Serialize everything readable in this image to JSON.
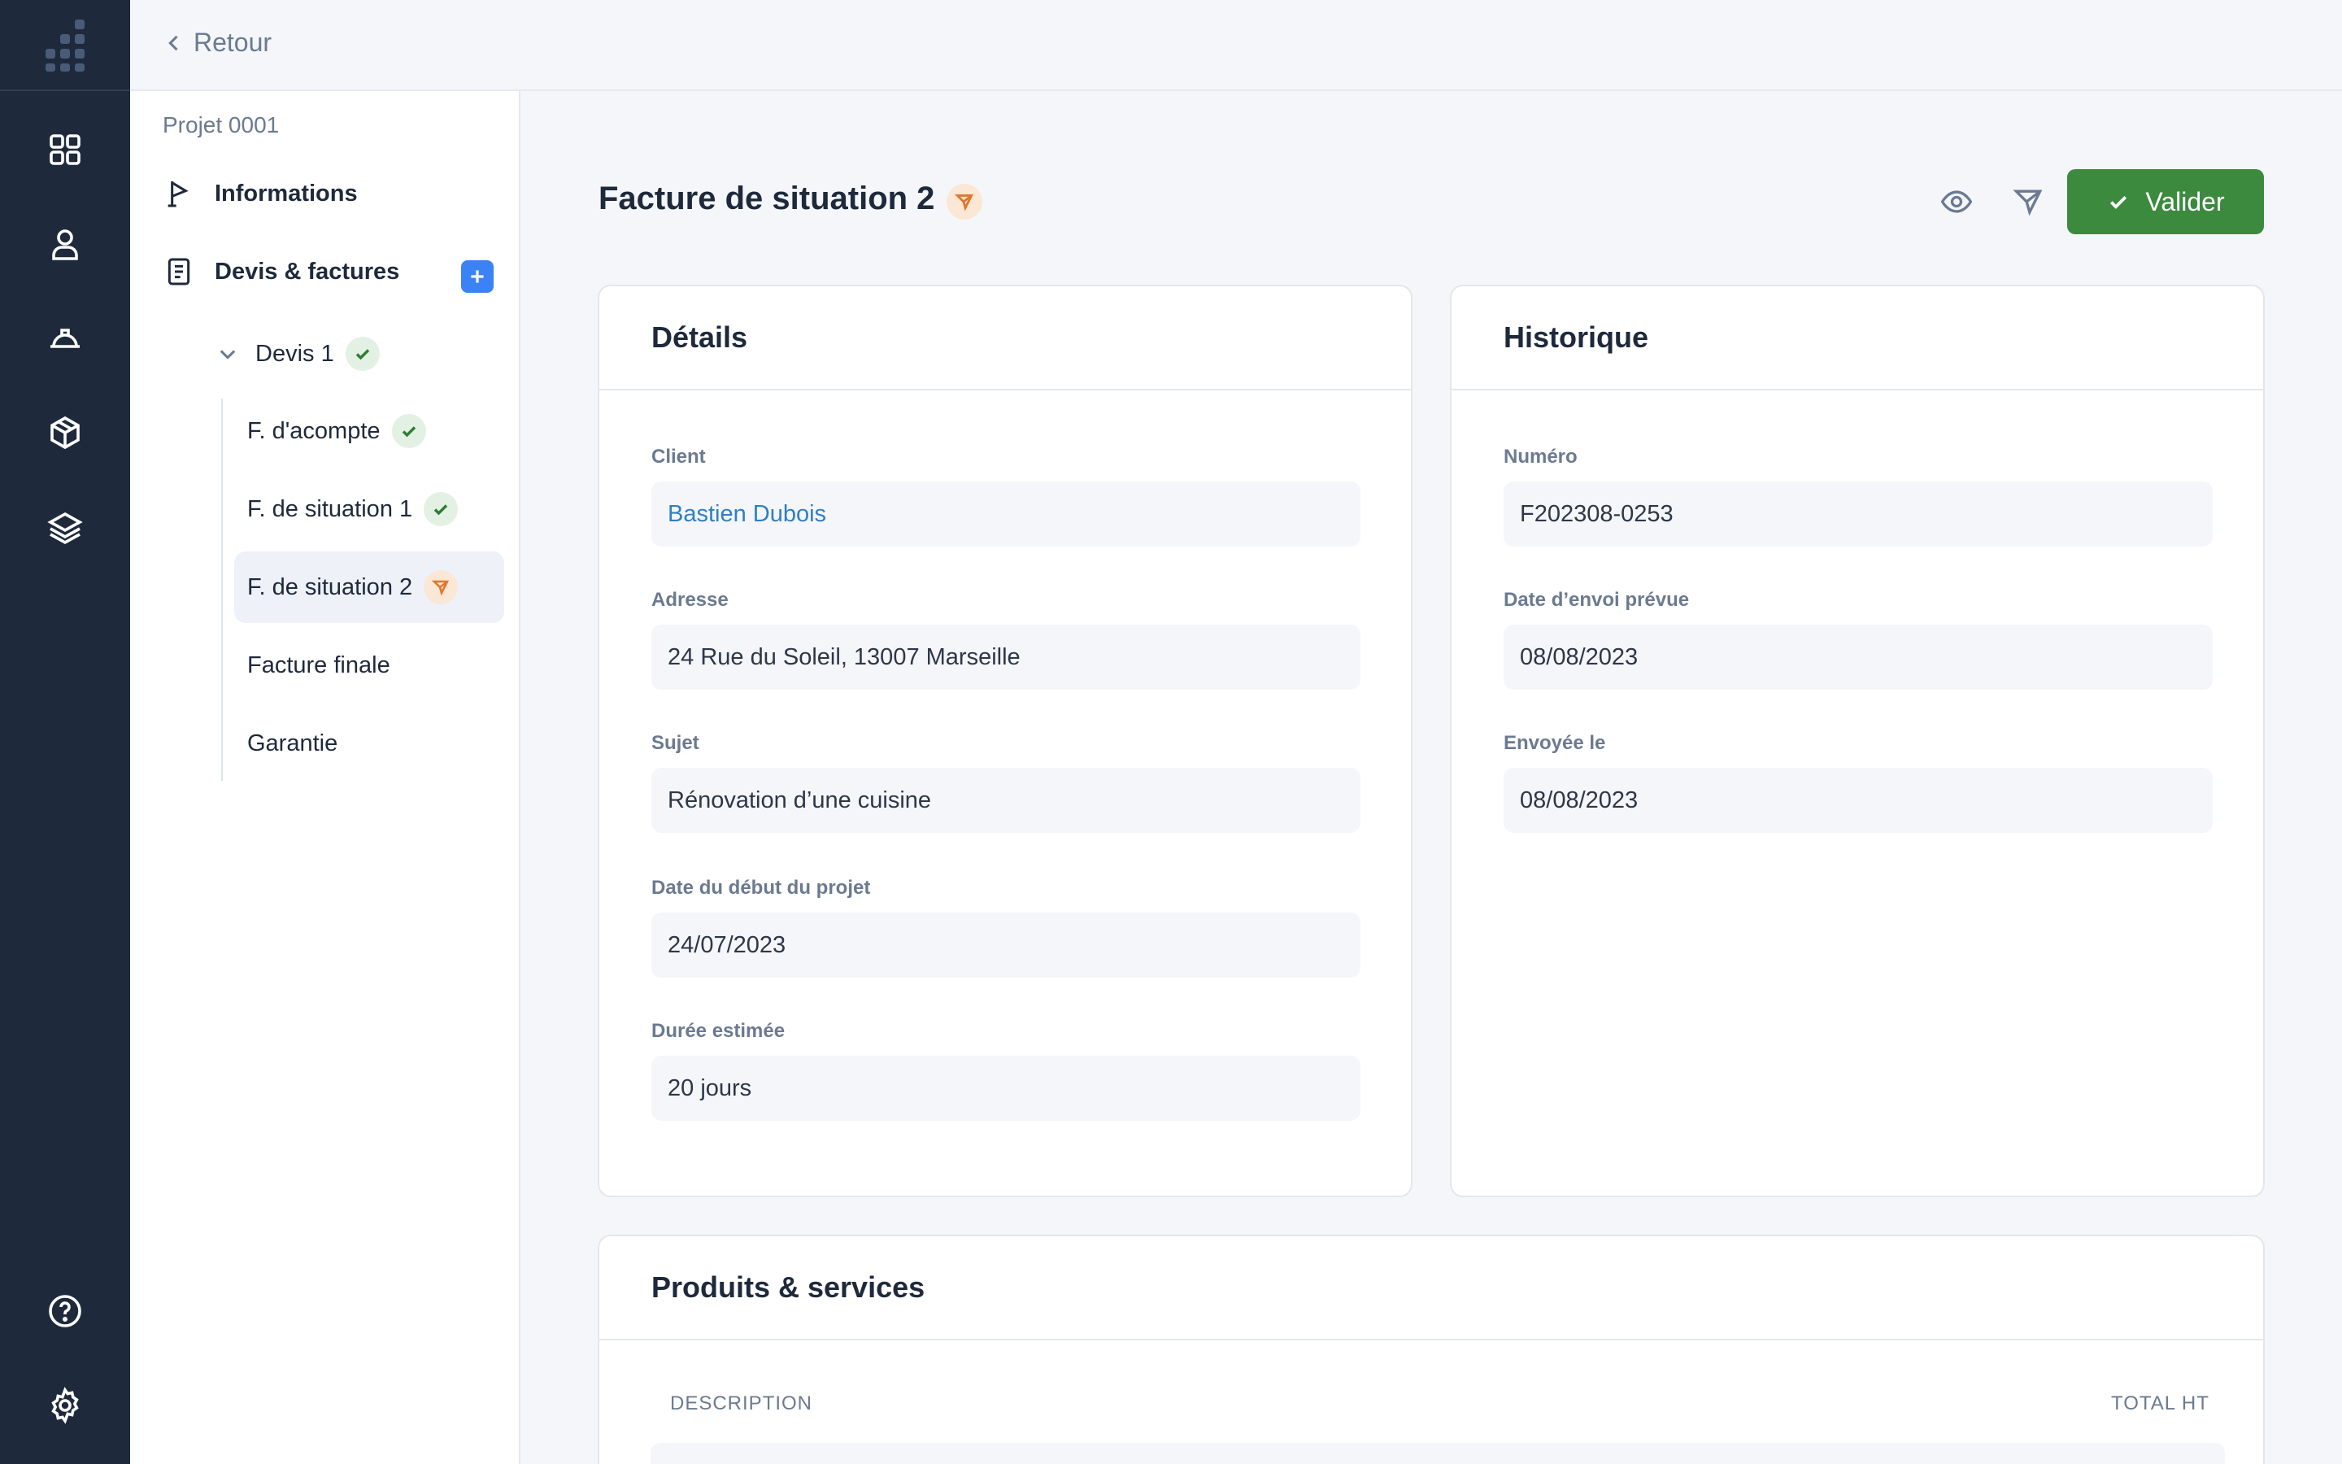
{
  "topbar": {
    "back_label": "Retour"
  },
  "sidebar": {
    "project_label": "Projet 0001",
    "informations_label": "Informations",
    "devis_factures_label": "Devis & factures",
    "devis_label": "Devis 1",
    "items": [
      {
        "label": "F. d'acompte",
        "status": "validated"
      },
      {
        "label": "F. de situation 1",
        "status": "validated"
      },
      {
        "label": "F. de situation 2",
        "status": "pending"
      },
      {
        "label": "Facture finale",
        "status": ""
      },
      {
        "label": "Garantie",
        "status": ""
      }
    ]
  },
  "main": {
    "title": "Facture de situation 2",
    "valider_label": "Valider"
  },
  "details": {
    "title": "Détails",
    "client_label": "Client",
    "client_value": "Bastien Dubois",
    "adresse_label": "Adresse",
    "adresse_value": "24 Rue du Soleil, 13007 Marseille",
    "sujet_label": "Sujet",
    "sujet_value": "Rénovation d’une cuisine",
    "date_debut_label": "Date du début du projet",
    "date_debut_value": "24/07/2023",
    "duree_label": "Durée estimée",
    "duree_value": "20 jours"
  },
  "historique": {
    "title": "Historique",
    "numero_label": "Numéro",
    "numero_value": "F202308-0253",
    "date_envoi_label": "Date d’envoi prévue",
    "date_envoi_value": "08/08/2023",
    "envoyee_label": "Envoyée le",
    "envoyee_value": "08/08/2023"
  },
  "produits": {
    "title": "Produits & services",
    "col_description": "DESCRIPTION",
    "col_total": "TOTAL HT"
  },
  "colors": {
    "rail_bg": "#1e2a3c",
    "validate_green": "#3b8a3e",
    "accent_blue": "#3b82f6",
    "pending_orange": "#e0772b",
    "link_blue": "#2f7fc4"
  }
}
